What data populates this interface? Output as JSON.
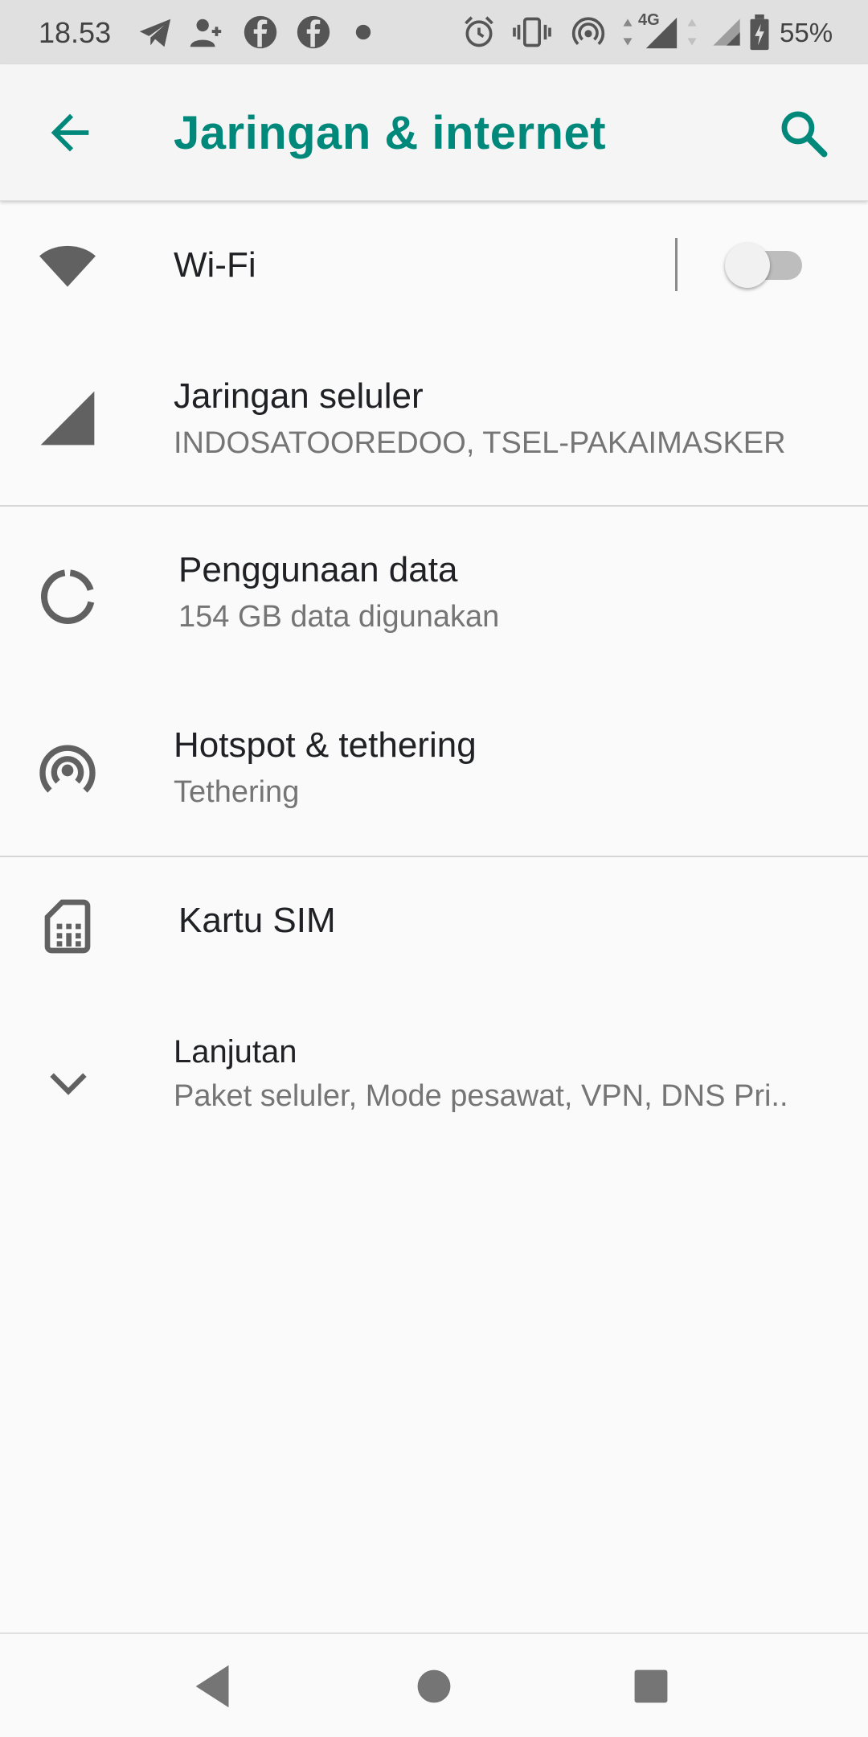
{
  "status_bar": {
    "time": "18.53",
    "network_type": "4G",
    "battery": "55%",
    "icons": [
      "telegram-icon",
      "contact-add-icon",
      "facebook-icon",
      "facebook-icon",
      "dot-icon",
      "alarm-icon",
      "vibrate-icon",
      "hotspot-icon",
      "signal-4g-icon",
      "signal-icon",
      "battery-icon"
    ]
  },
  "app_bar": {
    "title": "Jaringan & internet",
    "back_icon": "arrow-back-icon",
    "search_icon": "search-icon"
  },
  "items": [
    {
      "title": "Wi-Fi",
      "icon": "wifi-icon",
      "toggle": "off"
    },
    {
      "title": "Jaringan seluler",
      "subtitle": "INDOSATOOREDOO, TSEL-PAKAIMASKER",
      "icon": "cellular-signal-icon"
    },
    {
      "title": "Penggunaan data",
      "subtitle": "154 GB data digunakan",
      "icon": "data-usage-icon"
    },
    {
      "title": "Hotspot & tethering",
      "subtitle": "Tethering",
      "icon": "hotspot-icon"
    },
    {
      "title": "Kartu SIM",
      "icon": "sim-card-icon"
    },
    {
      "title": "Lanjutan",
      "subtitle": "Paket seluler, Mode pesawat, VPN, DNS Pri..",
      "icon": "chevron-down-icon"
    }
  ],
  "colors": {
    "accent": "#00897b",
    "status_bar_bg": "#e0e0e0",
    "background": "#fafafa",
    "primary_text": "#202124",
    "secondary_text": "#757575",
    "icon": "#616161"
  },
  "nav_bar": {
    "icons": [
      "nav-back-icon",
      "nav-home-icon",
      "nav-recents-icon"
    ]
  }
}
